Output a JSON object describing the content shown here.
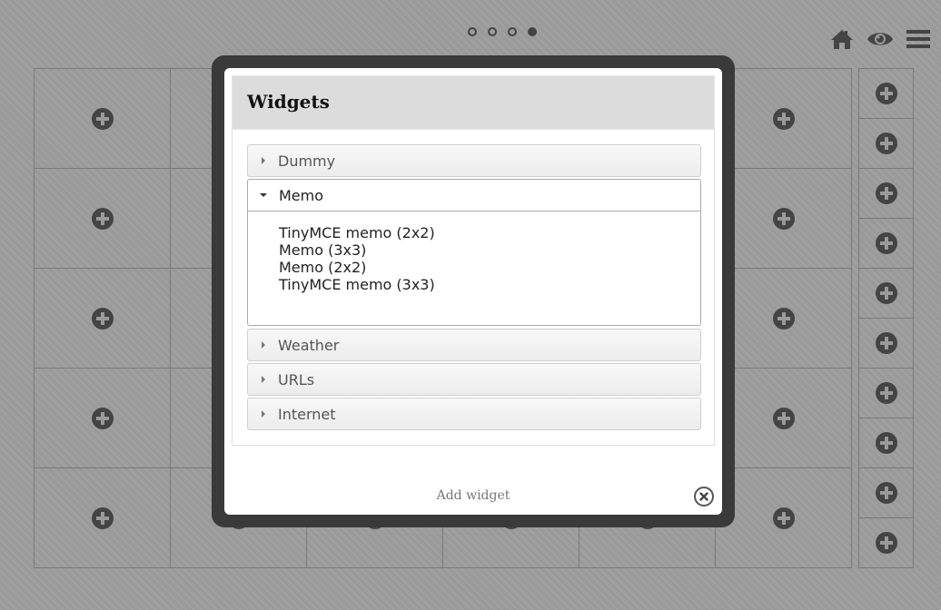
{
  "pagination": {
    "count": 4,
    "active_index": 3
  },
  "toolbar": {
    "icons": [
      "home-icon",
      "eye-icon",
      "hamburger-menu-icon"
    ]
  },
  "grid": {
    "columns": 6,
    "rows": 5,
    "side_rows": 10
  },
  "modal": {
    "title": "Widgets",
    "sections": [
      {
        "label": "Dummy",
        "expanded": false,
        "items": []
      },
      {
        "label": "Memo",
        "expanded": true,
        "items": [
          "TinyMCE memo (2x2)",
          "Memo (3x3)",
          "Memo (2x2)",
          "TinyMCE memo (3x3)"
        ]
      },
      {
        "label": "Weather",
        "expanded": false,
        "items": []
      },
      {
        "label": "URLs",
        "expanded": false,
        "items": []
      },
      {
        "label": "Internet",
        "expanded": false,
        "items": []
      }
    ],
    "footer_label": "Add widget"
  },
  "colors": {
    "background": "#9a9a9a",
    "dark": "#444444",
    "modal_frame": "#3a3a3a",
    "header": "#dcdcdc"
  }
}
